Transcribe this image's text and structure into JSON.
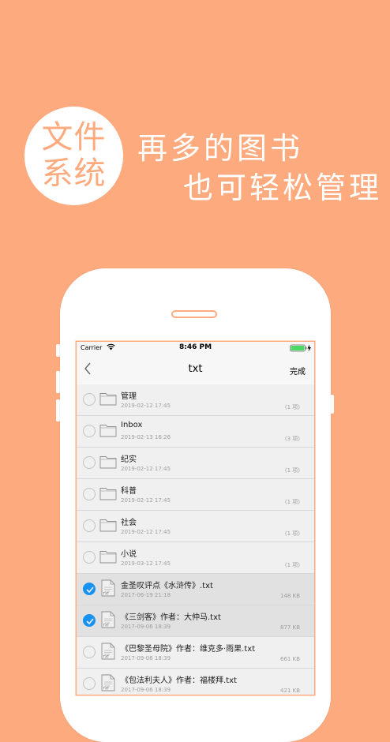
{
  "promo": {
    "badge_line1": "文件",
    "badge_line2": "系统",
    "headline_line1": "再多的图书",
    "headline_line2": "也可轻松管理"
  },
  "status_bar": {
    "carrier": "Carrier",
    "time": "8:46 PM"
  },
  "nav": {
    "title": "txt",
    "done_label": "完成"
  },
  "items": [
    {
      "type": "folder",
      "name": "管理",
      "date": "2019-02-12 17:45",
      "meta": "(1 项)",
      "selected": false
    },
    {
      "type": "folder",
      "name": "Inbox",
      "date": "2019-02-13 16:26",
      "meta": "(3 项)",
      "selected": false
    },
    {
      "type": "folder",
      "name": "纪实",
      "date": "2019-02-12 17:45",
      "meta": "(1 项)",
      "selected": false
    },
    {
      "type": "folder",
      "name": "科普",
      "date": "2019-02-12 17:45",
      "meta": "(1 项)",
      "selected": false
    },
    {
      "type": "folder",
      "name": "社会",
      "date": "2019-02-12 17:45",
      "meta": "(1 项)",
      "selected": false
    },
    {
      "type": "folder",
      "name": "小说",
      "date": "2019-03-12 17:45",
      "meta": "(1 项)",
      "selected": false
    },
    {
      "type": "file",
      "name": "金圣叹评点《水浒传》.txt",
      "date": "2017-06-19 21:18",
      "meta": "148 KB",
      "selected": true
    },
    {
      "type": "file",
      "name": "《三剑客》作者：大仲马.txt",
      "date": "2017-09-06 18:39",
      "meta": "877 KB",
      "selected": true
    },
    {
      "type": "file",
      "name": "《巴黎圣母院》作者：维克多·雨果.txt",
      "date": "2017-09-06 18:39",
      "meta": "661 KB",
      "selected": false
    },
    {
      "type": "file",
      "name": "《包法利夫人》作者：福楼拜.txt",
      "date": "2017-09-06 18:39",
      "meta": "421 KB",
      "selected": false
    }
  ],
  "colors": {
    "background": "#FDAB7E",
    "check_selected": "#1a9cff"
  },
  "icons": {
    "folder": "folder-icon",
    "file": "txt-file-icon",
    "back": "chevron-left-icon"
  }
}
